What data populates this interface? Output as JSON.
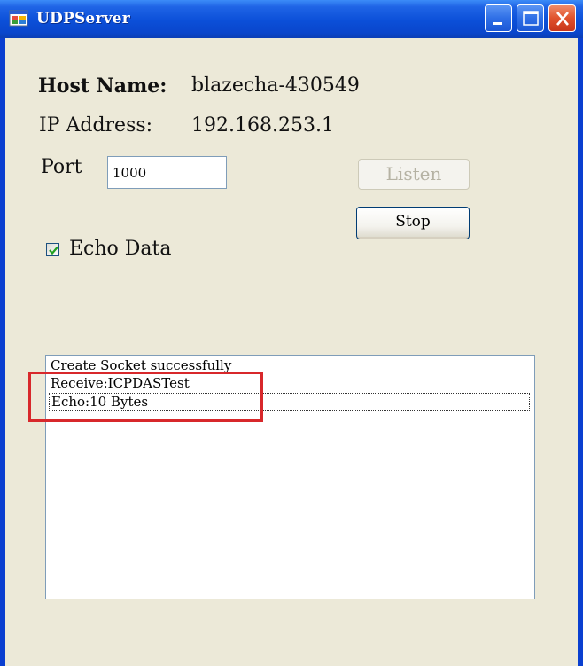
{
  "window": {
    "title": "UDPServer",
    "icons": {
      "app": "app-window-icon",
      "minimize": "minimize-icon",
      "maximize": "maximize-icon",
      "close": "close-icon"
    }
  },
  "form": {
    "host_label": "Host Name:",
    "host_value": "blazecha-430549",
    "ip_label": "IP Address:",
    "ip_value": "192.168.253.1",
    "port_label": "Port",
    "port_value": "1000",
    "listen_label": "Listen",
    "listen_enabled": false,
    "stop_label": "Stop",
    "echo_label": "Echo Data",
    "echo_checked": true
  },
  "log": {
    "items": [
      "Create Socket successfully",
      "Receive:ICPDASTest",
      "Echo:10 Bytes"
    ]
  },
  "colors": {
    "titlebar": "#0b4fd8",
    "client_bg": "#ece9d8",
    "close_button": "#e0522c",
    "annotation_box": "#d8282b"
  }
}
